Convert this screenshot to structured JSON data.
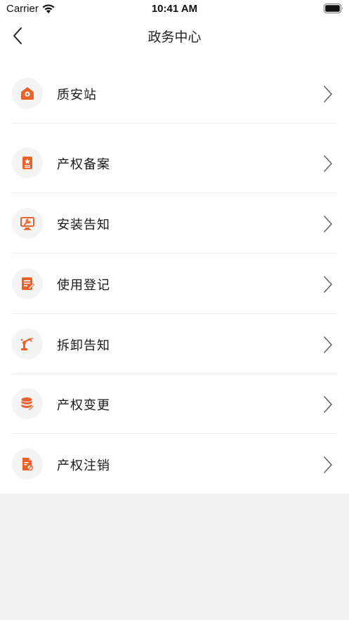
{
  "status_bar": {
    "carrier": "Carrier",
    "time": "10:41 AM"
  },
  "nav": {
    "title": "政务中心"
  },
  "colors": {
    "accent": "#e8632c",
    "icon_bg": "#f4f4f4",
    "divider": "#ececec",
    "page_bg": "#f2f2f2"
  },
  "menu": {
    "items": [
      {
        "label": "质安站",
        "icon": "location-home-icon"
      },
      {
        "label": "产权备案",
        "icon": "certificate-icon"
      },
      {
        "label": "安装告知",
        "icon": "monitor-wrench-icon"
      },
      {
        "label": "使用登记",
        "icon": "document-edit-icon"
      },
      {
        "label": "拆卸告知",
        "icon": "robot-arm-icon"
      },
      {
        "label": "产权变更",
        "icon": "database-edit-icon"
      },
      {
        "label": "产权注销",
        "icon": "file-cancel-icon"
      }
    ]
  }
}
